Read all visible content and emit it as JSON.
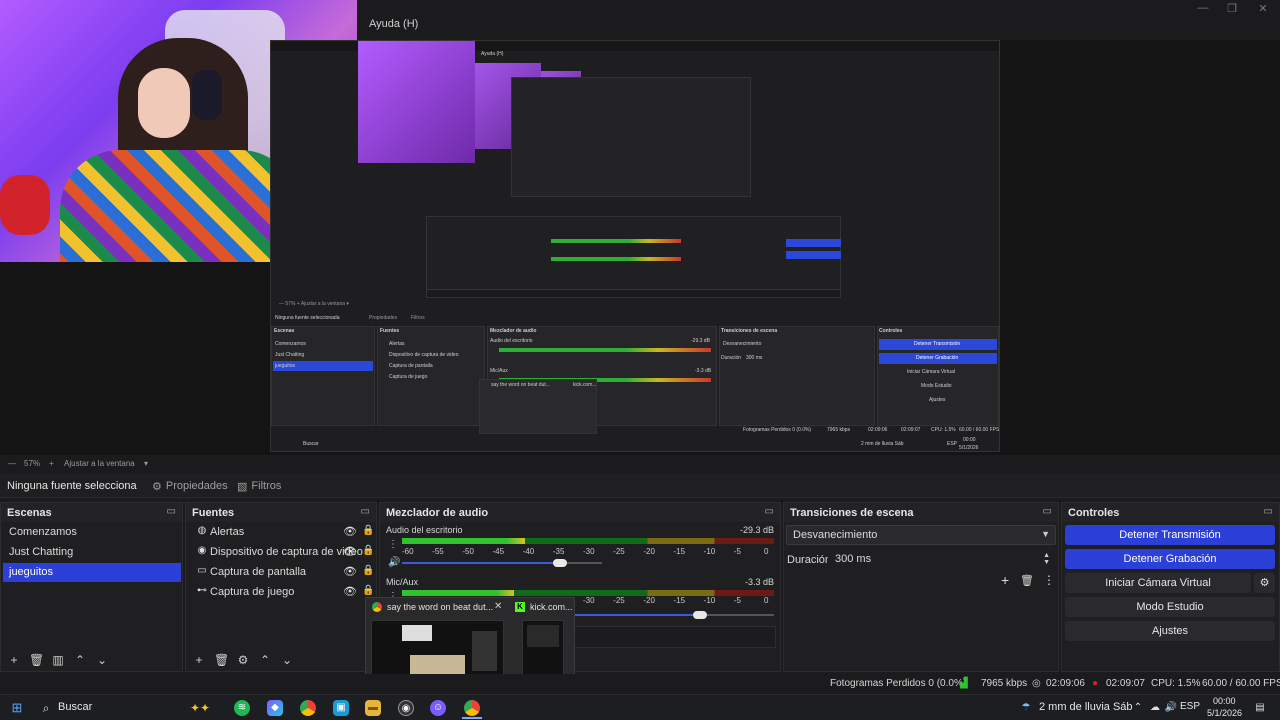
{
  "window": {
    "menu_help": "Ayuda (H)"
  },
  "preview": {
    "zoom": "57%",
    "fit_label": "Ajustar a la ventana",
    "nested_help": "Ayuda (H)",
    "nested_no_source": "Ninguna fuente seleccionada",
    "nested_props": "Propiedades",
    "nested_filters": "Filtros",
    "nested_scenes_title": "Escenas",
    "nested_scenes": [
      "Comenzamos",
      "Just Chatting",
      "jueguitos"
    ],
    "nested_sources_title": "Fuentes",
    "nested_sources": [
      "Alertas",
      "Dispositivo de captura de video",
      "Captura de pantalla",
      "Captura de juego"
    ],
    "nested_mixer_title": "Mezclador de audio",
    "nested_mixer_desktop": "Audio del escritorio",
    "nested_mixer_desktop_db": "-29.3 dB",
    "nested_mixer_mic": "Mic/Aux",
    "nested_mixer_mic_db": "-3.3 dB",
    "nested_trans_title": "Transiciones de escena",
    "nested_trans_value": "Desvanecimiento",
    "nested_duration_label": "Duración",
    "nested_duration_value": "300 ms",
    "nested_controls_title": "Controles",
    "nested_controls": [
      "Detener Transmisión",
      "Detener Grabación",
      "Iniciar Cámara Virtual",
      "Modo Estudio",
      "Ajustes"
    ],
    "nested_thumb1": "say the word on beat dut...",
    "nested_thumb2": "kick.com...",
    "nested_status": "Fotogramas Perdidos 0 (0.0%)",
    "nested_kbps": "7965 kbps",
    "nested_time1": "02:09:06",
    "nested_time2": "02:09:07",
    "nested_cpu": "CPU: 1.5%",
    "nested_fps": "60.00 / 60.00 FPS",
    "nested_search": "Buscar",
    "nested_weather": "2 mm de lluvia Sáb",
    "nested_lang": "ESP",
    "nested_clock_time": "00:00",
    "nested_clock_date": "5/1/2026"
  },
  "source_bar": {
    "no_source": "Ninguna fuente selecciona",
    "properties": "Propiedades",
    "filters": "Filtros"
  },
  "scenes": {
    "title": "Escenas",
    "items": [
      "Comenzamos",
      "Just Chatting",
      "jueguitos"
    ],
    "active_index": 2
  },
  "sources": {
    "title": "Fuentes",
    "items": [
      {
        "label": "Alertas",
        "icon": "globe-icon"
      },
      {
        "label": "Dispositivo de captura de video",
        "icon": "camera-icon"
      },
      {
        "label": "Captura de pantalla",
        "icon": "monitor-icon"
      },
      {
        "label": "Captura de juego",
        "icon": "gamepad-icon"
      }
    ]
  },
  "mixer": {
    "title": "Mezclador de audio",
    "desktop": {
      "name": "Audio del escritorio",
      "db": "-29.3 dB",
      "level": 0.33,
      "volume": 0.79
    },
    "mic": {
      "name": "Mic/Aux",
      "db": "-3.3 dB",
      "level": 0.3,
      "volume": 0.8
    },
    "ticks": [
      "-60",
      "-55",
      "-50",
      "-45",
      "-40",
      "-35",
      "-30",
      "-25",
      "-20",
      "-15",
      "-10",
      "-5",
      "0"
    ]
  },
  "transitions": {
    "title": "Transiciones de escena",
    "value": "Desvanecimiento",
    "duration_label": "Duración",
    "duration_value": "300 ms"
  },
  "controls": {
    "title": "Controles",
    "stop_stream": "Detener Transmisión",
    "stop_record": "Detener Grabación",
    "virtual_cam": "Iniciar Cámara Virtual",
    "studio_mode": "Modo Estudio",
    "settings": "Ajustes"
  },
  "taskbar_thumbs": {
    "thumb1_title": "say the word on beat dut...",
    "thumb2_title": "kick.com..."
  },
  "status": {
    "dropped_frames": "Fotogramas Perdidos 0 (0.0%)",
    "kbps": "7965 kbps",
    "stream_time": "02:09:06",
    "record_time": "02:09:07",
    "cpu": "CPU: 1.5%",
    "fps": "60.00 / 60.00 FPS"
  },
  "taskbar": {
    "search_placeholder": "Buscar",
    "weather": "2 mm de lluvia Sáb",
    "lang": "ESP",
    "clock_time": "00:00",
    "clock_date": "5/1/2026"
  },
  "colors": {
    "accent": "#2c3fd6",
    "meter_green": "#2ec32f",
    "meter_yellow": "#d8c325",
    "meter_red": "#c83a2a",
    "record_red": "#d3232a"
  }
}
